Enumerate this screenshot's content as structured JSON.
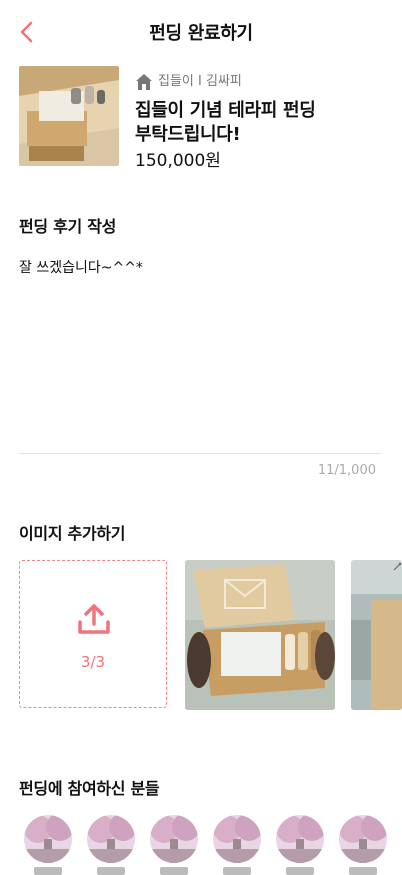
{
  "header": {
    "title": "펀딩 완료하기"
  },
  "product": {
    "owner": "집들이 I 김싸피",
    "title_line1": "집들이 기념 테라피 펀딩",
    "title_line2": "부탁드립니다!",
    "price": "150,000원"
  },
  "review": {
    "section_title": "펀딩 후기 작성",
    "text": "잘 쓰겠습니다~^^*",
    "counter": "11/1,000"
  },
  "images": {
    "section_title": "이미지 추가하기",
    "upload_count": "3/3"
  },
  "participants": {
    "section_title": "펀딩에 참여하신 분들",
    "count": 6
  },
  "colors": {
    "accent": "#f07479",
    "text": "#111111",
    "muted": "#aaaaaa"
  }
}
